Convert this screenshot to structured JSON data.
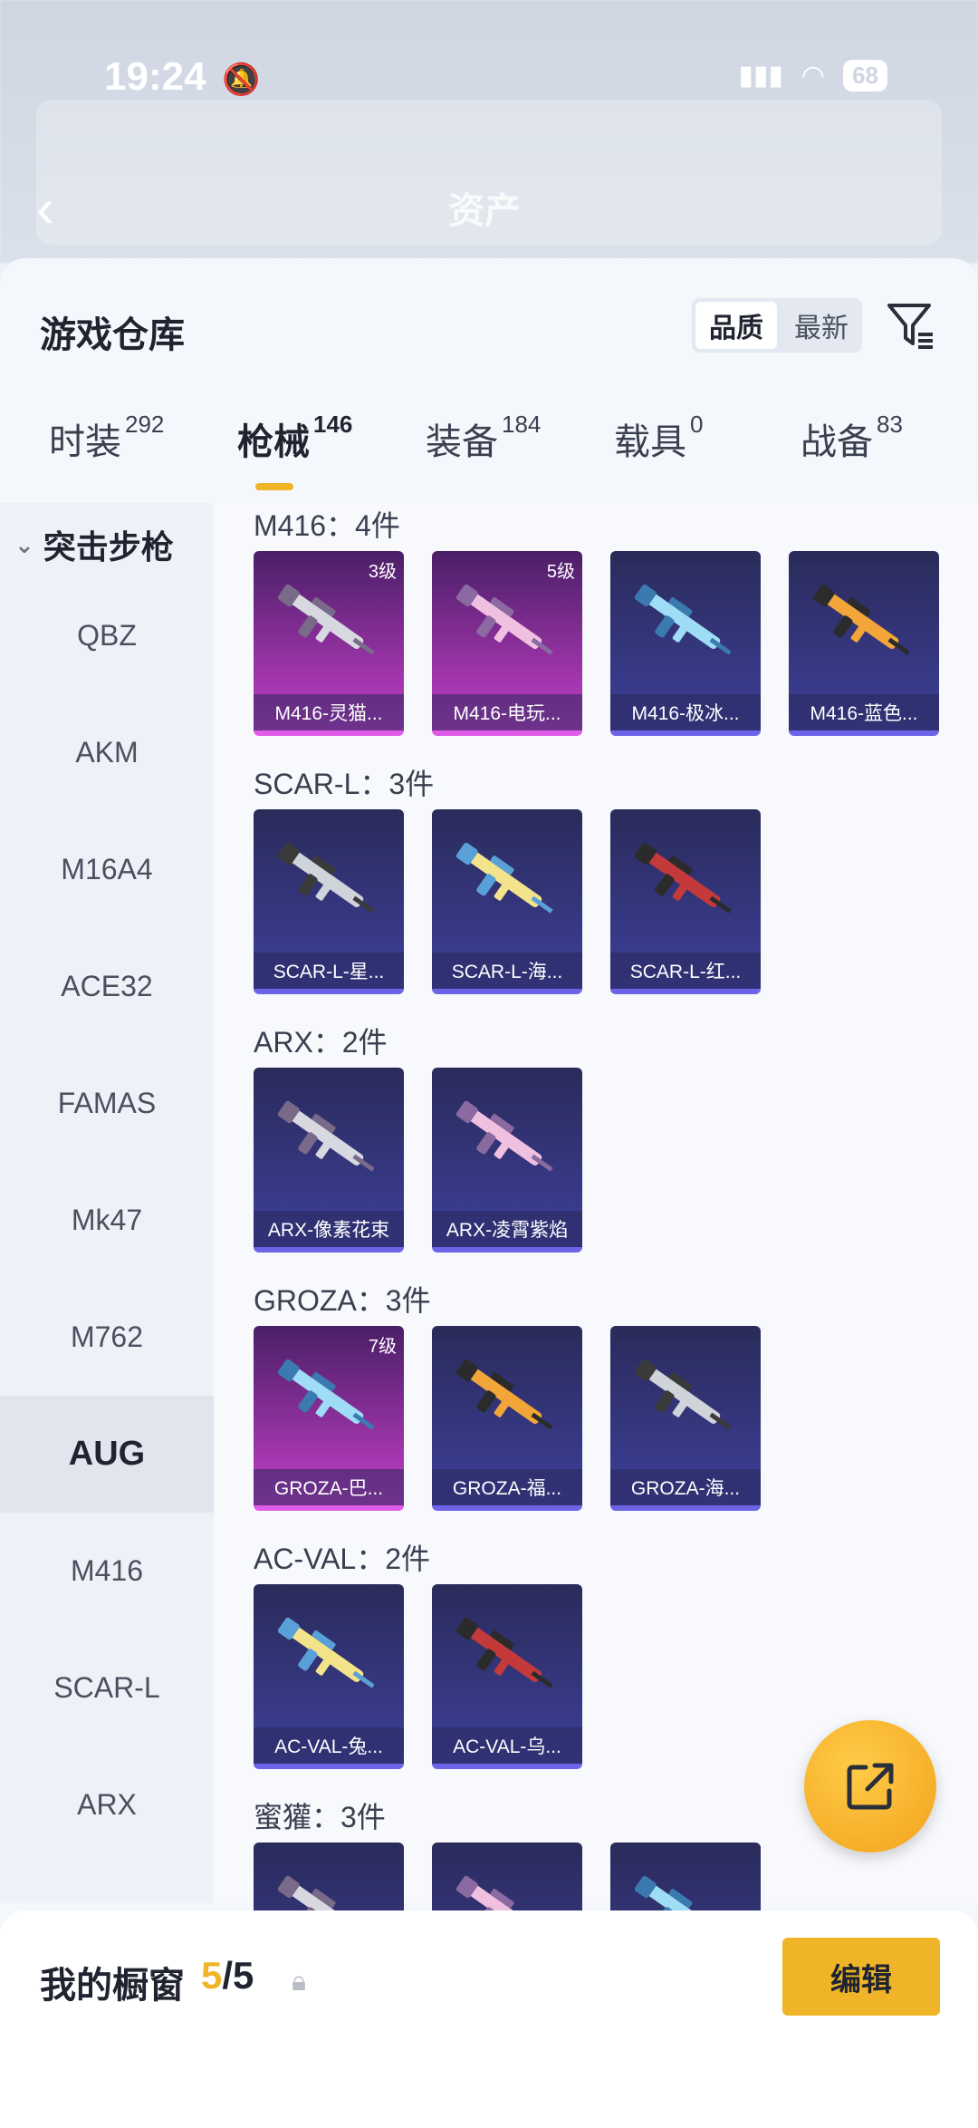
{
  "status_bar": {
    "time": "19:24",
    "battery": "68"
  },
  "header": {
    "back_label": "‹",
    "blurred_title": "资产"
  },
  "sheet": {
    "title": "游戏仓库",
    "sort_options": [
      "品质",
      "最新"
    ],
    "tabs": [
      {
        "label": "时装",
        "count": "292"
      },
      {
        "label": "枪械",
        "count": "146"
      },
      {
        "label": "装备",
        "count": "184"
      },
      {
        "label": "载具",
        "count": "0"
      },
      {
        "label": "战备",
        "count": "83"
      }
    ]
  },
  "sidebar": {
    "category": "突击步枪",
    "items": [
      "QBZ",
      "AKM",
      "M16A4",
      "ACE32",
      "FAMAS",
      "Mk47",
      "M762",
      "AUG",
      "M416",
      "SCAR-L",
      "ARX"
    ],
    "active_item": "AUG"
  },
  "groups": [
    {
      "title": "M416：4件",
      "items": [
        {
          "name": "M416-灵猫...",
          "level": "3级",
          "rarity": "purple"
        },
        {
          "name": "M416-电玩...",
          "level": "5级",
          "rarity": "purple"
        },
        {
          "name": "M416-极冰...",
          "level": "",
          "rarity": "blue"
        },
        {
          "name": "M416-蓝色...",
          "level": "",
          "rarity": "blue"
        }
      ]
    },
    {
      "title": "SCAR-L：3件",
      "items": [
        {
          "name": "SCAR-L-星...",
          "level": "",
          "rarity": "blue"
        },
        {
          "name": "SCAR-L-海...",
          "level": "",
          "rarity": "blue"
        },
        {
          "name": "SCAR-L-红...",
          "level": "",
          "rarity": "blue"
        }
      ]
    },
    {
      "title": "ARX：2件",
      "items": [
        {
          "name": "ARX-像素花束",
          "level": "",
          "rarity": "blue"
        },
        {
          "name": "ARX-凌霄紫焰",
          "level": "",
          "rarity": "blue"
        }
      ]
    },
    {
      "title": "GROZA：3件",
      "items": [
        {
          "name": "GROZA-巴...",
          "level": "7级",
          "rarity": "purple"
        },
        {
          "name": "GROZA-福...",
          "level": "",
          "rarity": "blue"
        },
        {
          "name": "GROZA-海...",
          "level": "",
          "rarity": "blue"
        }
      ]
    },
    {
      "title": "AC-VAL：2件",
      "items": [
        {
          "name": "AC-VAL-兔...",
          "level": "",
          "rarity": "blue"
        },
        {
          "name": "AC-VAL-乌...",
          "level": "",
          "rarity": "blue"
        }
      ]
    },
    {
      "title": "蜜獾：3件",
      "items": [
        {
          "name": "",
          "level": "",
          "rarity": "blue"
        },
        {
          "name": "",
          "level": "",
          "rarity": "blue"
        },
        {
          "name": "",
          "level": "",
          "rarity": "blue"
        }
      ]
    }
  ],
  "bottom_bar": {
    "label": "我的橱窗",
    "current": "5",
    "total": "/5",
    "edit_label": "编辑"
  },
  "colors": {
    "accent": "#f0b429",
    "purple_rarity": "#c43ec9",
    "blue_rarity": "#3d3f9a"
  }
}
